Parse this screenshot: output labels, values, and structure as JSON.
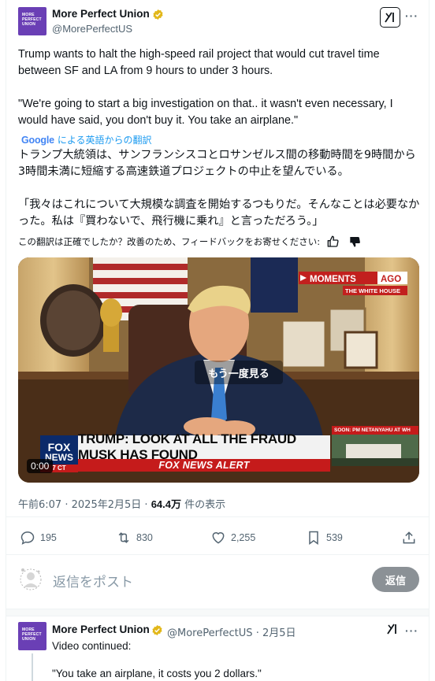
{
  "author": {
    "avatar_lines": [
      "MORE",
      "PERFECT",
      "UNION"
    ],
    "name": "More Perfect Union",
    "handle": "@MorePerfectUS"
  },
  "tweet": {
    "paragraphs": [
      "Trump wants to halt the high-speed rail project that would cut travel time between SF and LA from 9 hours to under 3 hours.",
      "\"We're going to start a big investigation on that.. it wasn't even necessary, I would have said, you don't buy it. You take an airplane.\""
    ]
  },
  "translation": {
    "google_logo": "Google",
    "source_label": "による英語からの翻訳",
    "paragraphs": [
      "トランプ大統領は、サンフランシスコとロサンゼルス間の移動時間を9時間から3時間未満に短縮する高速鉄道プロジェクトの中止を望んでいる。",
      "「我々はこれについて大規模な調査を開始するつもりだ。そんなことは必要なかった。私は『買わないで、飛行機に乗れ』と言っただろう。」"
    ],
    "feedback_prompt": "この翻訳は正確でしたか？改善のため、フィードバックをお寄せください:"
  },
  "video": {
    "replay_label": "もう一度見る",
    "time": "0:00",
    "moments_word": "MOMENTS",
    "ago_word": "AGO",
    "moments_source": "THE WHITE HOUSE",
    "chyron_main": "TRUMP: LOOK AT ALL THE FRAUD MUSK HAS FOUND",
    "chyron_sub": "FOX NEWS ALERT",
    "fox_logo_top": "FOX",
    "fox_logo_bottom": "NEWS",
    "fox_time": "7 CT",
    "soon_label": "SOON: PM NETANYAHU AT WH"
  },
  "meta": {
    "time": "午前6:07",
    "date": "2025年2月5日",
    "views_count": "64.4万",
    "views_label": "件の表示",
    "separator": "·"
  },
  "actions": {
    "replies": "195",
    "reposts": "830",
    "likes": "2,255",
    "bookmarks": "539"
  },
  "reply_box": {
    "placeholder": "返信をポスト",
    "button_label": "返信"
  },
  "reply_tweet": {
    "name": "More Perfect Union",
    "handle": "@MorePerfectUS",
    "separator": "·",
    "date": "2月5日",
    "text": "Video continued:",
    "quote": "\"You take an airplane, it costs you 2 dollars.\""
  },
  "colors": {
    "brand_purple": "#6a3fb5",
    "link_blue": "#1d9bf0",
    "muted": "#536471",
    "verified_gold": "#e2b719",
    "reply_button": "#8b9196"
  }
}
